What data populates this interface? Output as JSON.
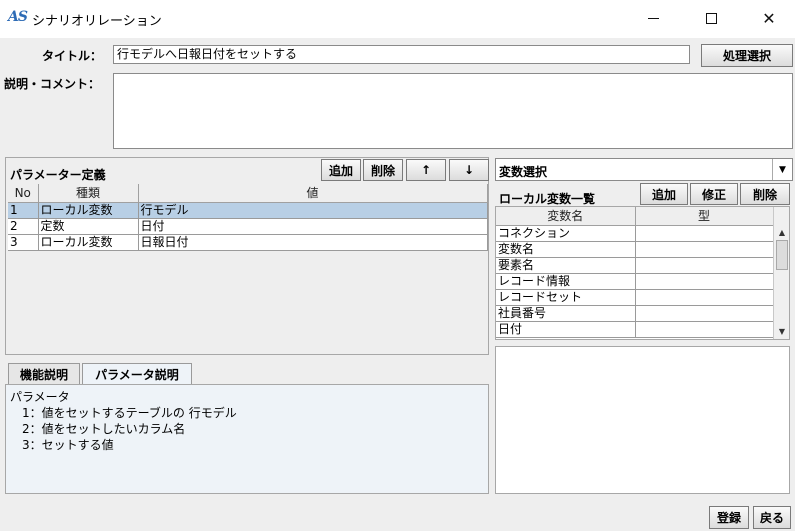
{
  "window": {
    "logo": "AS",
    "title": "シナリオリレーション",
    "minimize_icon": "minimize-icon",
    "maximize_icon": "maximize-icon",
    "close_icon": "close-icon",
    "close_glyph": "✕"
  },
  "form": {
    "title_label": "タイトル：",
    "title_value": "行モデルへ日報日付をセットする",
    "process_button": "処理選択",
    "comment_label": "説明・コメント：",
    "comment_value": ""
  },
  "params": {
    "section_title": "パラメーター定義",
    "add_button": "追加",
    "delete_button": "削除",
    "up_button": "↑",
    "down_button": "↓",
    "columns": [
      "No",
      "種類",
      "値"
    ],
    "rows": [
      {
        "no": "1",
        "kind": "ローカル変数",
        "value": "行モデル"
      },
      {
        "no": "2",
        "kind": "定数",
        "value": "日付"
      },
      {
        "no": "3",
        "kind": "ローカル変数",
        "value": "日報日付"
      }
    ]
  },
  "variables": {
    "select_value": "変数選択",
    "section_title": "ローカル変数一覧",
    "add_button": "追加",
    "edit_button": "修正",
    "delete_button": "削除",
    "columns": [
      "変数名",
      "型"
    ],
    "rows": [
      {
        "name": "コネクション",
        "type": ""
      },
      {
        "name": "変数名",
        "type": ""
      },
      {
        "name": "要素名",
        "type": ""
      },
      {
        "name": "レコード情報",
        "type": ""
      },
      {
        "name": "レコードセット",
        "type": ""
      },
      {
        "name": "社員番号",
        "type": ""
      },
      {
        "name": "日付",
        "type": ""
      }
    ]
  },
  "tabs": {
    "function_tab": "機能説明",
    "param_tab": "パラメータ説明",
    "description_lines": [
      "パラメータ",
      "　1：値をセットするテーブルの 行モデル",
      "　2：値をセットしたいカラム名",
      "　3：セットする値"
    ]
  },
  "footer": {
    "register_button": "登録",
    "back_button": "戻る"
  }
}
